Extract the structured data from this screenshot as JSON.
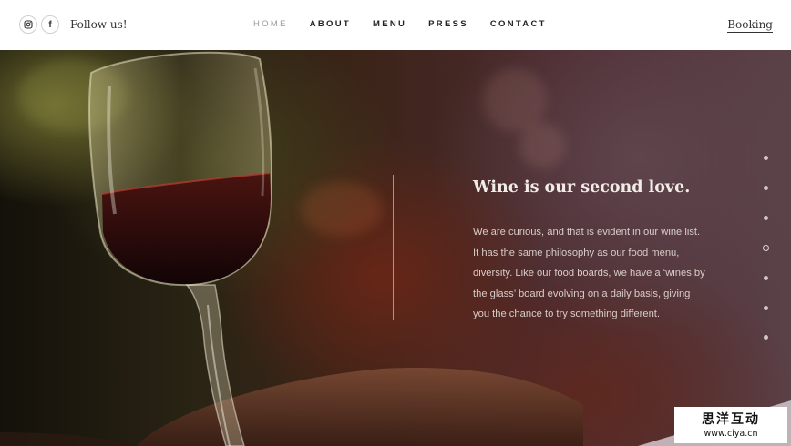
{
  "header": {
    "social": [
      {
        "icon": "instagram-icon"
      },
      {
        "icon": "facebook-icon",
        "glyph": "f"
      }
    ],
    "follow_label": "Follow us!",
    "nav": [
      {
        "label": "HOME",
        "active": true
      },
      {
        "label": "ABOUT",
        "active": false
      },
      {
        "label": "MENU",
        "active": false
      },
      {
        "label": "PRESS",
        "active": false
      },
      {
        "label": "CONTACT",
        "active": false
      }
    ],
    "booking_label": "Booking"
  },
  "hero": {
    "heading": "Wine is our second love.",
    "paragraph_lines": [
      "We are curious, and that is evident in our wine list.",
      "It has the same philosophy as our food menu,",
      "diversity. Like our food boards, we have a ‘wines by",
      "the glass’ board evolving on a daily basis, giving",
      "you the chance to try something different."
    ],
    "slide_count": 7,
    "active_slide": 4
  },
  "watermark": {
    "text": "思洋互动",
    "url": "www.ciya.cn"
  },
  "colors": {
    "header_bg": "#ffffff",
    "nav_active": "#9a9a9a",
    "nav_text": "#222222",
    "heading_text": "#f2ece6",
    "body_text": "#d8ccc8"
  }
}
